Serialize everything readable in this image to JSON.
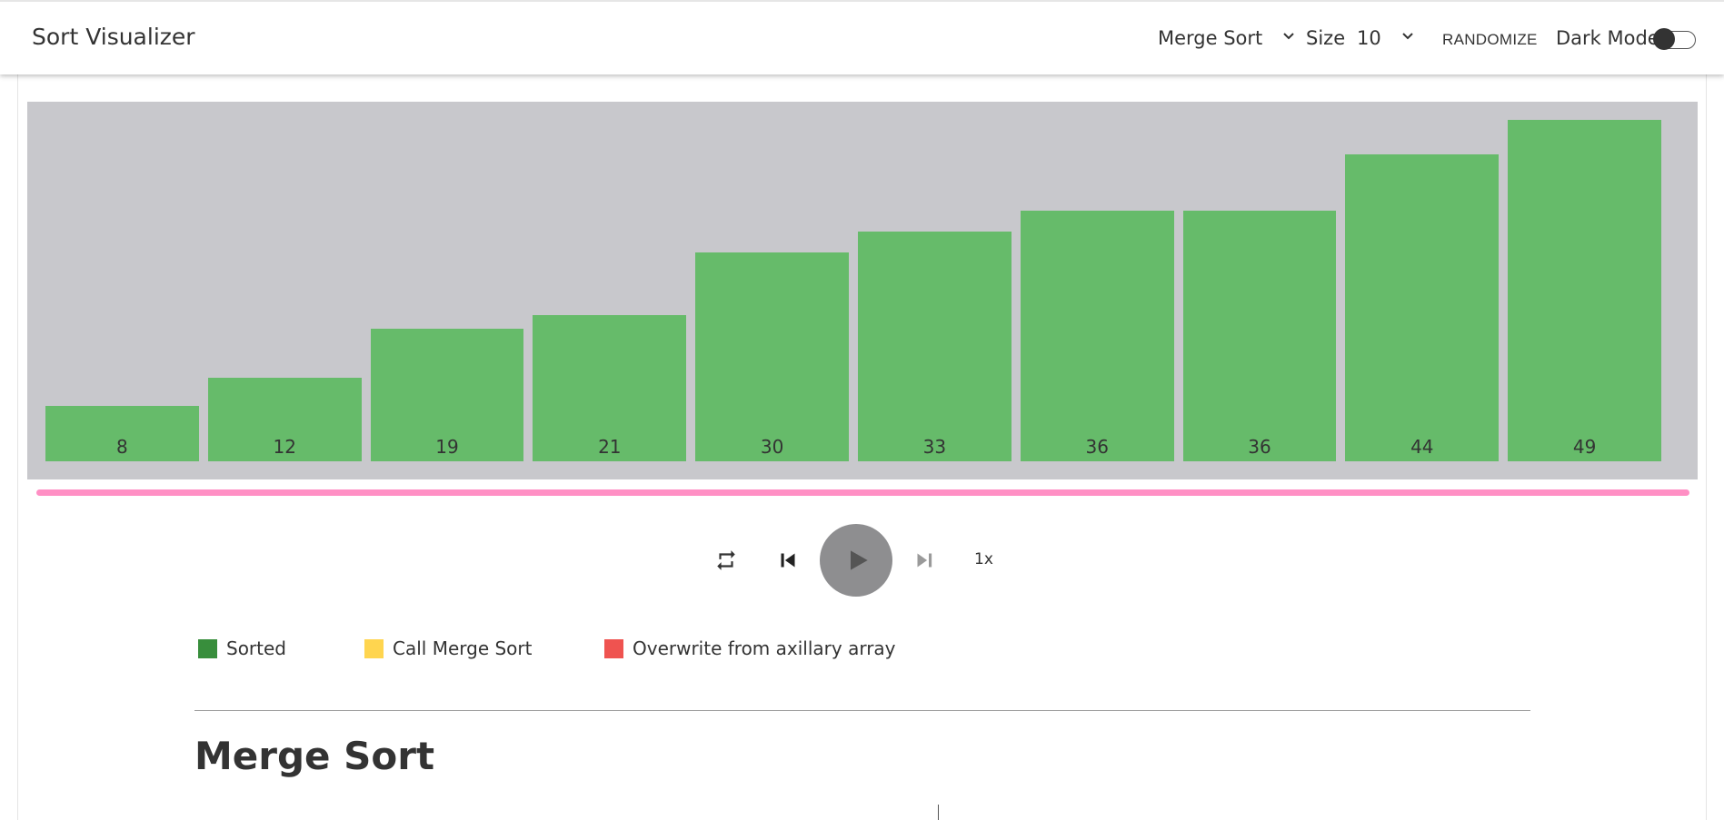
{
  "app": {
    "title": "Sort Visualizer"
  },
  "toolbar": {
    "algorithm": "Merge Sort",
    "size_label": "Size",
    "size_value": "10",
    "randomize_label": "RANDOMIZE",
    "dark_mode_label": "Dark Mode",
    "dark_mode_on": false
  },
  "chart_data": {
    "type": "bar",
    "categories": [
      "8",
      "12",
      "19",
      "21",
      "30",
      "33",
      "36",
      "36",
      "44",
      "49"
    ],
    "values": [
      8,
      12,
      19,
      21,
      30,
      33,
      36,
      36,
      44,
      49
    ],
    "bar_color": "#66bb6a",
    "background_color": "#c8c8cc"
  },
  "progress": {
    "fraction": 1.0,
    "color": "#ff8fc4"
  },
  "controls": {
    "repeat_icon": "repeat-icon",
    "previous_icon": "skip-previous-icon",
    "play_icon": "play-icon",
    "next_icon": "skip-next-icon",
    "speed": "1x"
  },
  "legend": [
    {
      "label": "Sorted",
      "color": "#388e3c"
    },
    {
      "label": "Call Merge Sort",
      "color": "#ffd54f"
    },
    {
      "label": "Overwrite from axillary array",
      "color": "#ef5350"
    }
  ],
  "section": {
    "title": "Merge Sort"
  }
}
